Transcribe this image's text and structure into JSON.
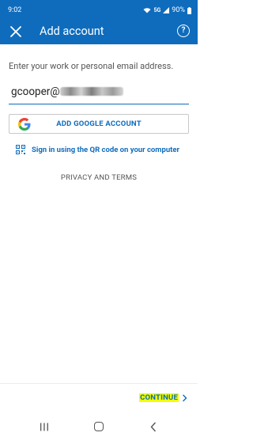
{
  "status_bar": {
    "time": "9:02",
    "network": "5G",
    "battery": "90%"
  },
  "app_bar": {
    "title": "Add account",
    "close_icon": "close-icon",
    "help_icon": "help-icon",
    "help_glyph": "?"
  },
  "form": {
    "prompt": "Enter your work or personal email address.",
    "email_value_visible": "gcooper@",
    "email_domain_redacted": true
  },
  "actions": {
    "google_button_label": "ADD GOOGLE ACCOUNT",
    "qr_label": "Sign in using the QR code on your computer",
    "privacy_label": "PRIVACY AND TERMS",
    "continue_label": "CONTINUE"
  },
  "colors": {
    "accent": "#0f6cbd",
    "highlight": "#f2ff00"
  }
}
